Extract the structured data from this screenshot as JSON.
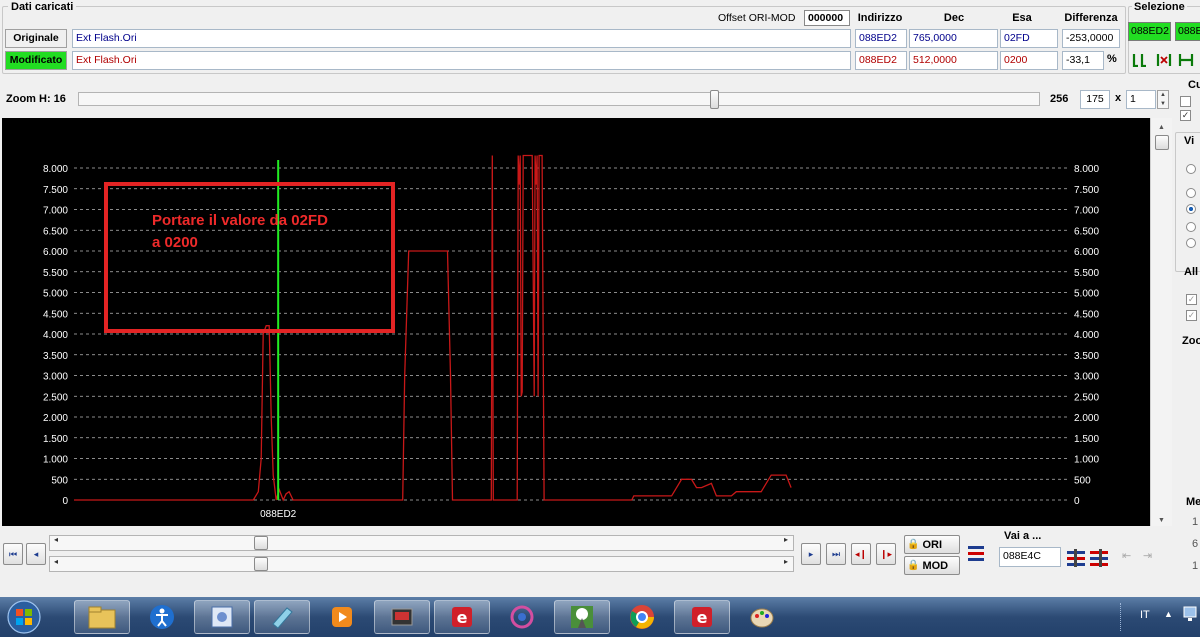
{
  "dati": {
    "group_title": "Dati caricati",
    "offset_label": "Offset ORI-MOD",
    "offset_value": "000000",
    "headers": {
      "indirizzo": "Indirizzo",
      "dec": "Dec",
      "esa": "Esa",
      "differenza": "Differenza"
    },
    "originale": {
      "label": "Originale",
      "file": "Ext Flash.Ori",
      "indirizzo": "088ED2",
      "dec": "765,0000",
      "esa": "02FD",
      "differenza": "-253,0000"
    },
    "modificato": {
      "label": "Modificato",
      "file": "Ext Flash.Ori",
      "indirizzo": "088ED2",
      "dec": "512,0000",
      "esa": "0200",
      "differenza": "-33,1",
      "percent": "%"
    }
  },
  "selezione": {
    "title": "Selezione",
    "value1": "088ED2",
    "value2": "088E"
  },
  "zoom": {
    "label": "Zoom H: 16",
    "value_256": "256",
    "value_175": "175",
    "x_label": "x",
    "multiplier": "1"
  },
  "right_panel": {
    "c_label": "Cu",
    "vi_label": "Vi",
    "all_label": "All",
    "zoo_label": "Zoo",
    "me_label": "Me",
    "n1": "1",
    "n2": "6",
    "n3": "1"
  },
  "chart_data": {
    "type": "line",
    "y_ticks": [
      "8.000",
      "7.500",
      "7.000",
      "6.500",
      "6.000",
      "5.500",
      "5.000",
      "4.500",
      "4.000",
      "3.500",
      "3.000",
      "2.500",
      "2.000",
      "1.500",
      "1.000",
      "500",
      "0"
    ],
    "ylim": [
      0,
      8000
    ],
    "cursor_label": "088ED2",
    "cursor_color": "#22ee22",
    "line_color": "#c81818",
    "grid": true,
    "annotation_text_line1": "Portare il valore da 02FD",
    "annotation_text_line2": "a 0200",
    "series": [
      {
        "points": [
          [
            0,
            0
          ],
          [
            170,
            0
          ],
          [
            180,
            0
          ],
          [
            185,
            200
          ],
          [
            188,
            1000
          ],
          [
            190,
            4000
          ],
          [
            193,
            4200
          ],
          [
            196,
            4200
          ],
          [
            198,
            2000
          ],
          [
            200,
            600
          ],
          [
            203,
            0
          ],
          [
            206,
            250
          ],
          [
            210,
            0
          ],
          [
            213,
            150
          ],
          [
            216,
            200
          ],
          [
            220,
            0
          ],
          [
            230,
            0
          ],
          [
            300,
            0
          ],
          [
            330,
            0
          ],
          [
            332,
            3000
          ],
          [
            336,
            6000
          ],
          [
            350,
            6000
          ],
          [
            375,
            6000
          ],
          [
            378,
            3000
          ],
          [
            380,
            0
          ],
          [
            400,
            0
          ],
          [
            419,
            0
          ],
          [
            420,
            8300
          ],
          [
            421,
            0
          ],
          [
            445,
            0
          ],
          [
            446,
            8300
          ],
          [
            447,
            7600
          ],
          [
            448,
            8300
          ],
          [
            449,
            2500
          ],
          [
            450,
            2600
          ],
          [
            451,
            8300
          ],
          [
            460,
            8300
          ],
          [
            462,
            2500
          ],
          [
            463,
            8300
          ],
          [
            464,
            7600
          ],
          [
            465,
            8300
          ],
          [
            466,
            2500
          ],
          [
            467,
            8300
          ],
          [
            468,
            8300
          ],
          [
            470,
            8300
          ],
          [
            472,
            0
          ],
          [
            480,
            0
          ],
          [
            560,
            0
          ],
          [
            562,
            100
          ],
          [
            590,
            100
          ],
          [
            600,
            100
          ],
          [
            610,
            500
          ],
          [
            620,
            500
          ],
          [
            625,
            300
          ],
          [
            630,
            300
          ],
          [
            640,
            400
          ],
          [
            645,
            100
          ],
          [
            660,
            100
          ],
          [
            665,
            200
          ],
          [
            690,
            200
          ],
          [
            700,
            600
          ],
          [
            715,
            600
          ],
          [
            720,
            300
          ]
        ]
      }
    ]
  },
  "nav": {
    "vai_label": "Vai a ...",
    "vai_value": "088E4C",
    "ori_label": "ORI",
    "mod_label": "MOD"
  },
  "taskbar": {
    "lang": "IT"
  }
}
